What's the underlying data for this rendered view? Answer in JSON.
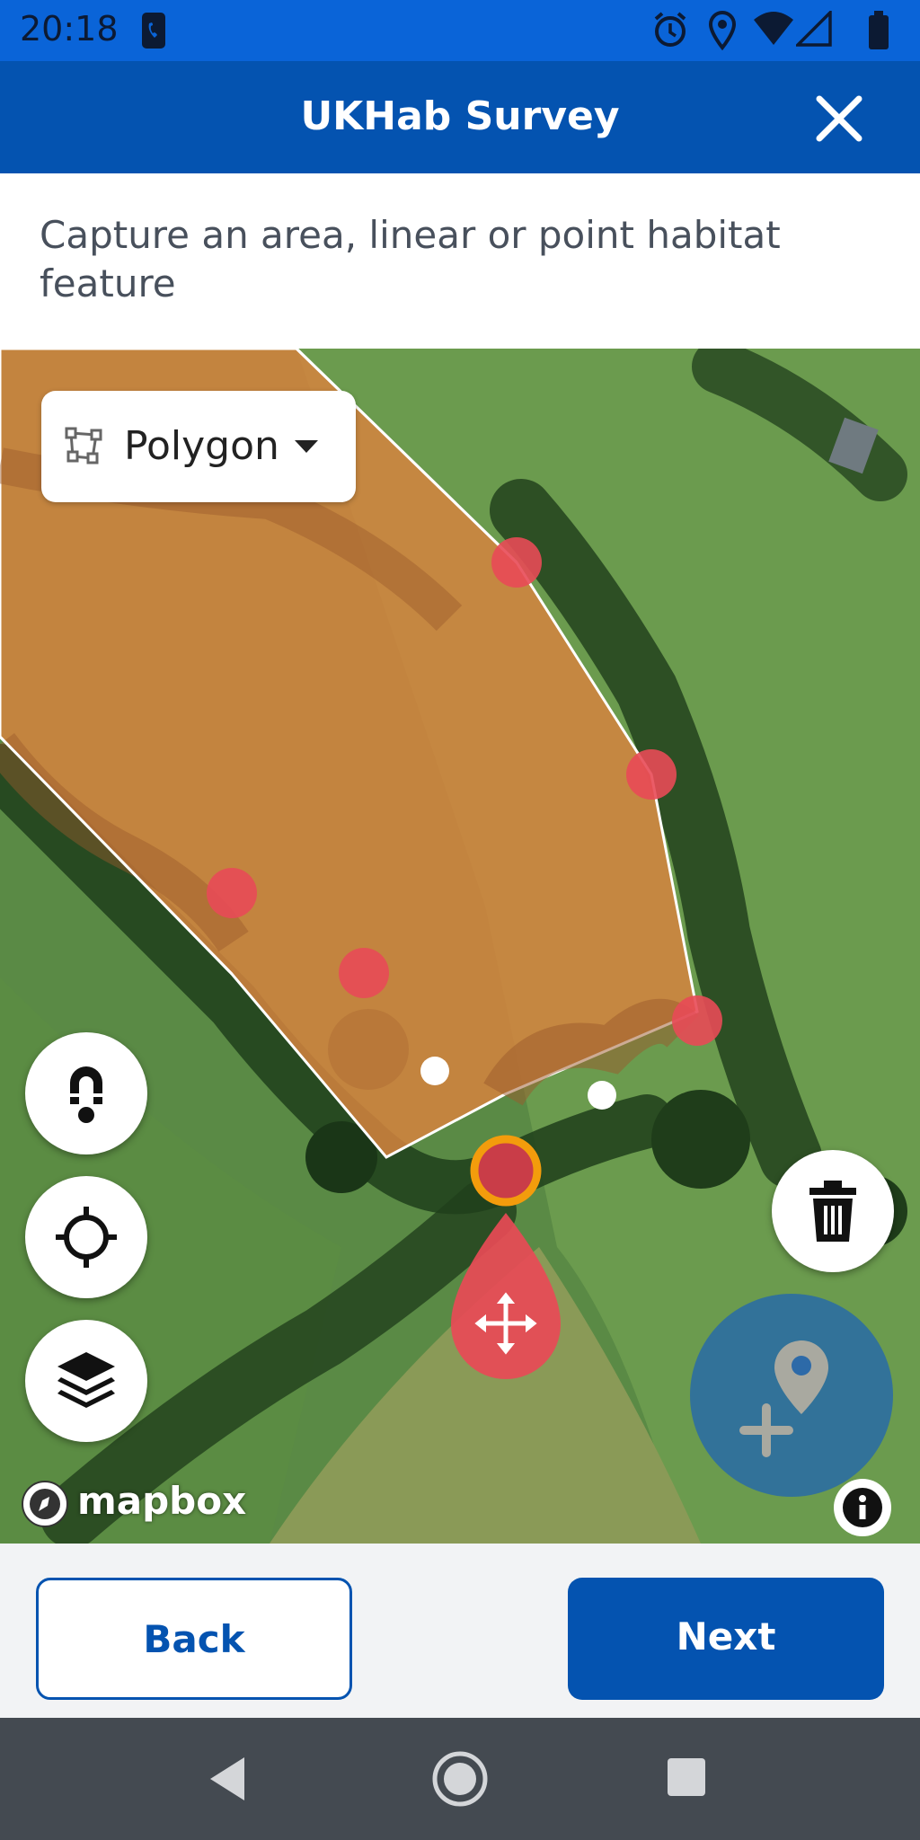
{
  "status_bar": {
    "time": "20:18",
    "icons": [
      "phone-icon",
      "alarm-icon",
      "location-icon",
      "wifi-icon",
      "signal-icon",
      "battery-icon"
    ]
  },
  "header": {
    "title": "UKHab Survey",
    "close_icon": "close-icon"
  },
  "instruction": {
    "text": "Capture an area, linear or point habitat feature"
  },
  "map": {
    "geometry_selector": {
      "icon": "polygon-icon",
      "label": "Polygon",
      "caret_icon": "caret-down-icon"
    },
    "controls": [
      {
        "name": "snap-toggle-button",
        "icon": "magnet-icon"
      },
      {
        "name": "locate-button",
        "icon": "crosshair-icon"
      },
      {
        "name": "layers-button",
        "icon": "layers-icon"
      }
    ],
    "delete_icon": "trash-icon",
    "add_point_icon": "add-location-icon",
    "info_icon": "info-icon",
    "move_handle_icon": "move-icon",
    "attribution": "mapbox",
    "colors": {
      "polygon_fill": "#d4833f",
      "vertex": "#e84a56",
      "selected_vertex_ring": "#f39c0c"
    }
  },
  "footer": {
    "back_label": "Back",
    "next_label": "Next"
  },
  "nav_bar": {
    "icons": [
      "back-nav-icon",
      "home-nav-icon",
      "recents-nav-icon"
    ]
  },
  "colors": {
    "primary": "#0453b0",
    "status_bar": "#0a64d8"
  }
}
